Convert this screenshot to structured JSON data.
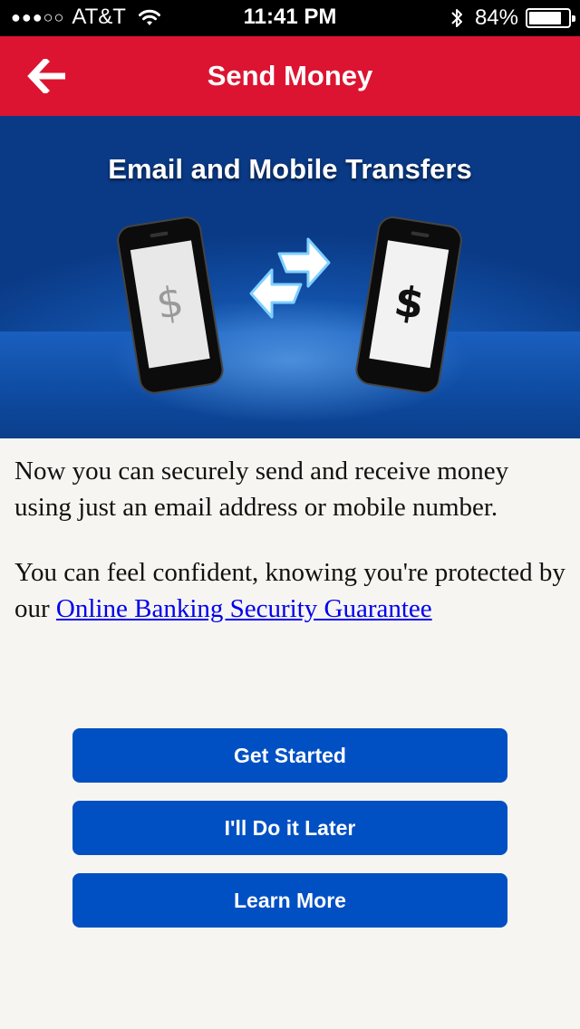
{
  "status_bar": {
    "signal": "●●●○○",
    "carrier": "AT&T",
    "time": "11:41 PM",
    "battery_percent": "84%",
    "battery_level": 0.84,
    "icons": [
      "wifi-icon",
      "bluetooth-icon",
      "battery-icon"
    ]
  },
  "nav": {
    "title": "Send Money",
    "back_icon": "back-arrow-icon"
  },
  "banner": {
    "heading": "Email and Mobile Transfers",
    "phone_left_symbol": "$",
    "phone_right_symbol": "$"
  },
  "content": {
    "paragraph1": "Now you can securely send and receive money using just an email address or mobile number.",
    "paragraph2_prefix": "You can feel confident, knowing you're protected by our ",
    "paragraph2_link": "Online Banking Security Guarantee"
  },
  "buttons": {
    "get_started": "Get Started",
    "do_it_later": "I'll Do it Later",
    "learn_more": "Learn More"
  },
  "colors": {
    "nav_red": "#dc1431",
    "button_blue": "#0050c3",
    "link_blue": "#0000ee",
    "background": "#f6f5f1"
  }
}
